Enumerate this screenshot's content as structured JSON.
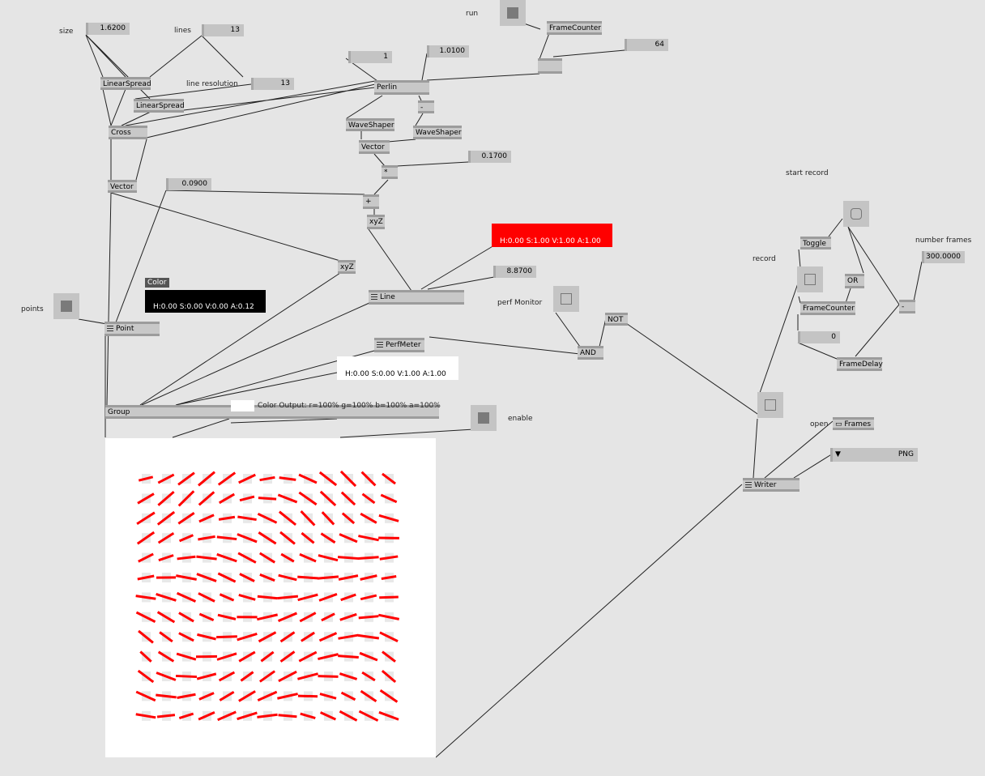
{
  "labels": {
    "size": "size",
    "lines": "lines",
    "line_resolution": "line resolution",
    "run": "run",
    "points": "points",
    "start_record": "start record",
    "record": "record",
    "number_frames": "number frames",
    "perf_monitor": "perf Monitor",
    "enable": "enable",
    "open": "open"
  },
  "values": {
    "size": "1.6200",
    "lines": "13",
    "line_resolution": "13",
    "frame_step": "64",
    "perlin_a": "1",
    "perlin_b": "1.0100",
    "scale": "0.1700",
    "offset": "0.0900",
    "line_width": "8.8700",
    "number_frames": "300.0000",
    "frame_zero": "0"
  },
  "nodes": {
    "frame_counter": "FrameCounter",
    "frame_counter_2": "FrameCounter",
    "linear_spread": "LinearSpread",
    "linear_spread_2": "LinearSpread",
    "cross": "Cross",
    "perlin": "Perlin",
    "minus": "-",
    "waveshaper": "WaveShaper",
    "waveshaper_2": "WaveShaper",
    "vector": "Vector",
    "vector_2": "Vector",
    "mul": "*",
    "plus": "+",
    "xyz": "xyZ",
    "xyz_2": "xyZ",
    "line": "Line",
    "point": "Point",
    "perfmeter": "PerfMeter",
    "and": "AND",
    "not": "NOT",
    "group": "Group",
    "toggle": "Toggle",
    "or": "OR",
    "frame_delay": "FrameDelay",
    "minus_2": "-",
    "writer": "Writer"
  },
  "colors": {
    "color_title": "Color",
    "point_color": "H:0.00  S:0.00  V:0.00  A:0.12",
    "line_color": "H:0.00  S:1.00  V:1.00  A:1.00",
    "perf_color": "H:0.00  S:0.00  V:1.00  A:1.00",
    "color_output": "Color Output:  r=100% g=100% b=100% a=100%",
    "red": "#ff0000",
    "black": "#000000",
    "white": "#ffffff"
  },
  "writer_controls": {
    "folder": "Frames",
    "format": "PNG"
  }
}
